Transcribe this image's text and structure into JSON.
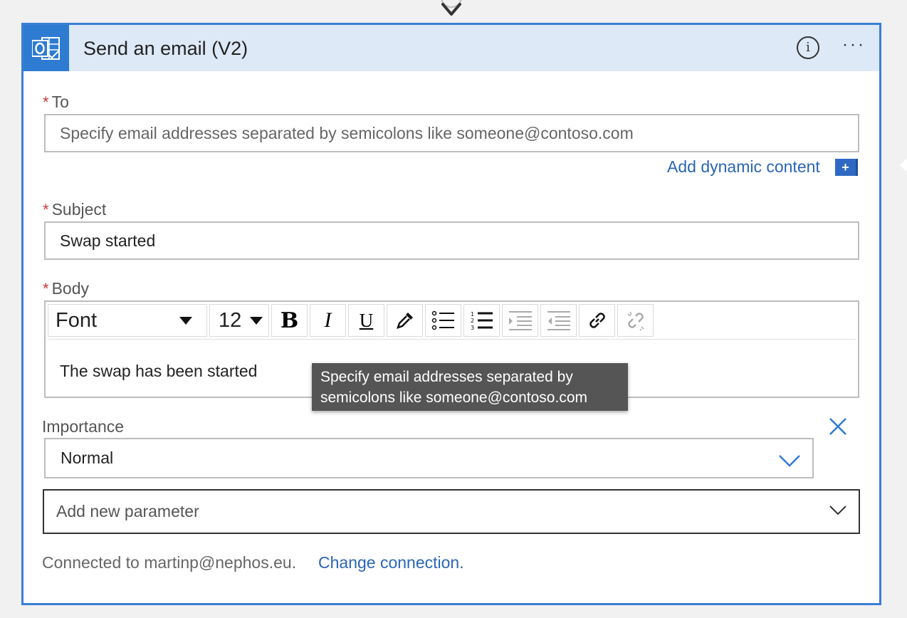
{
  "card": {
    "title": "Send an email (V2)",
    "header_icon": "outlook-icon",
    "info_icon": "i"
  },
  "to": {
    "label": "To",
    "placeholder": "Specify email addresses separated by semicolons like someone@contoso.com",
    "required_mark": "*"
  },
  "dynamic_content": {
    "label": "Add dynamic content",
    "plus": "+"
  },
  "subject": {
    "label": "Subject",
    "value": "Swap started",
    "required_mark": "*"
  },
  "body": {
    "label": "Body",
    "required_mark": "*",
    "text": "The swap has been started",
    "toolbar": {
      "font": "Font",
      "size": "12",
      "bold": "B",
      "italic": "I",
      "underline": "U"
    }
  },
  "tooltip": {
    "line1": "Specify email addresses separated by",
    "line2": "semicolons like someone@contoso.com"
  },
  "importance": {
    "label": "Importance",
    "value": "Normal"
  },
  "add_parameter": {
    "label": "Add new parameter"
  },
  "connection": {
    "text": "Connected to martinp@nephos.eu.",
    "link": "Change connection."
  },
  "colors": {
    "accent": "#2e7bd2",
    "header_bg": "#dde9f7",
    "required": "#d13438",
    "link": "#2a65b5",
    "tooltip_bg": "#555555"
  }
}
